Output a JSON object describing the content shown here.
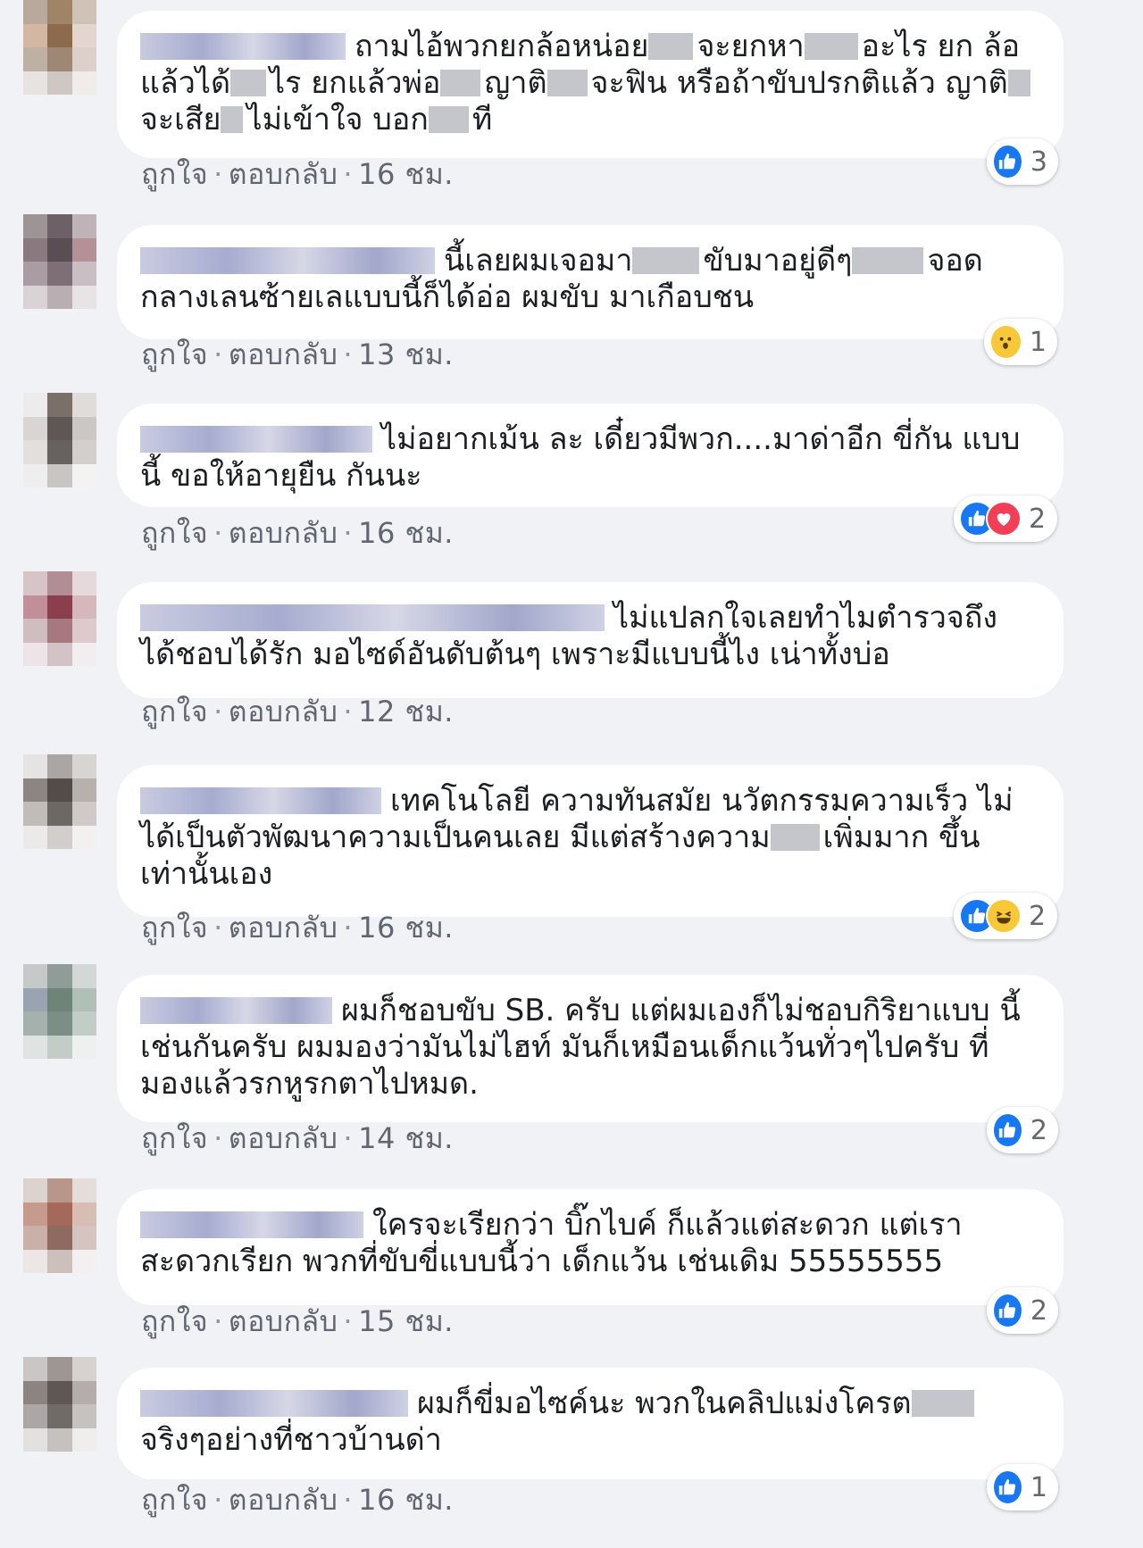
{
  "colors": {
    "background": "#f0f2f5",
    "bubble": "#ffffff",
    "like": "#1877f2",
    "love": "#f33e58",
    "emoji": "#f7c838",
    "meta_text": "#616770"
  },
  "comments": [
    {
      "segments": [
        "ถามไอ้พวกยกล้อหน่อย",
        "จะยกหา",
        "อะไร ยก ล้อแล้วได้",
        "ไร ยกแล้วพ่อ",
        "ญาติ",
        "จะฟิน หรือถ้าขับปรกติแล้ว ญาติ",
        "จะเสีย",
        "ไม่เข้าใจ บอก",
        "ที"
      ],
      "like_label": "ถูกใจ",
      "reply_label": "ตอบกลับ",
      "time": "16 ชม.",
      "reactions": [
        "like-icon"
      ],
      "reaction_count": "3"
    },
    {
      "segments": [
        "นี้เลยผมเจอมา",
        "ขับมาอยู่ดีๆ",
        "จอด กลางเลนซ้ายเลแบบนี้ก็ได้อ่อ ผมขับ มาเกือบชน"
      ],
      "like_label": "ถูกใจ",
      "reply_label": "ตอบกลับ",
      "time": "13 ชม.",
      "reactions": [
        "wow-icon"
      ],
      "reaction_count": "1"
    },
    {
      "segments": [
        "ไม่อยากเม้น ละ เดี๋ยวมีพวก....มาด่าอีก ขี่กัน แบบนี้ ขอให้อายุยืน กันนะ"
      ],
      "like_label": "ถูกใจ",
      "reply_label": "ตอบกลับ",
      "time": "16 ชม.",
      "reactions": [
        "like-icon",
        "love-icon"
      ],
      "reaction_count": "2"
    },
    {
      "segments": [
        "ไม่แปลกใจเลยทำไมตำรวจถึง ได้ชอบได้รัก มอไซด์อันดับต้นๆ เพราะมีแบบนี้ไง เน่าทั้งบ่อ"
      ],
      "like_label": "ถูกใจ",
      "reply_label": "ตอบกลับ",
      "time": "12 ชม.",
      "reactions": [],
      "reaction_count": ""
    },
    {
      "segments": [
        "เทคโนโลยี ความทันสมัย นวัตกรรมความเร็ว ไม่ได้เป็นตัวพัฒนาความเป็นคนเลย มีแต่สร้างความ",
        "เพิ่มมาก ขึ้นเท่านั้นเอง"
      ],
      "like_label": "ถูกใจ",
      "reply_label": "ตอบกลับ",
      "time": "16 ชม.",
      "reactions": [
        "like-icon",
        "haha-icon"
      ],
      "reaction_count": "2"
    },
    {
      "segments": [
        "ผมก็ชอบขับ SB. ครับ แต่ผมเองก็ไม่ชอบกิริยาแบบ นี้เช่นกันครับ ผมมองว่ามันไม่ไฮท์ มันก็เหมือนเด็กแว้นทั่วๆไปครับ ที่มองแล้วรกหูรกตาไปหมด."
      ],
      "like_label": "ถูกใจ",
      "reply_label": "ตอบกลับ",
      "time": "14 ชม.",
      "reactions": [
        "like-icon"
      ],
      "reaction_count": "2"
    },
    {
      "segments": [
        "ใครจะเรียกว่า บิ๊กไบค์ ก็แล้วแต่สะดวก แต่เรา สะดวกเรียก พวกที่ขับขี่แบบนี้ว่า เด็กแว้น เช่นเดิม 55555555"
      ],
      "like_label": "ถูกใจ",
      "reply_label": "ตอบกลับ",
      "time": "15 ชม.",
      "reactions": [
        "like-icon"
      ],
      "reaction_count": "2"
    },
    {
      "segments": [
        "ผมก็ขี่มอไซค์นะ พวกในคลิปแม่งโครต",
        "จริงๆอย่างที่ชาวบ้านด่า"
      ],
      "like_label": "ถูกใจ",
      "reply_label": "ตอบกลับ",
      "time": "16 ชม.",
      "reactions": [
        "like-icon"
      ],
      "reaction_count": "1"
    }
  ]
}
